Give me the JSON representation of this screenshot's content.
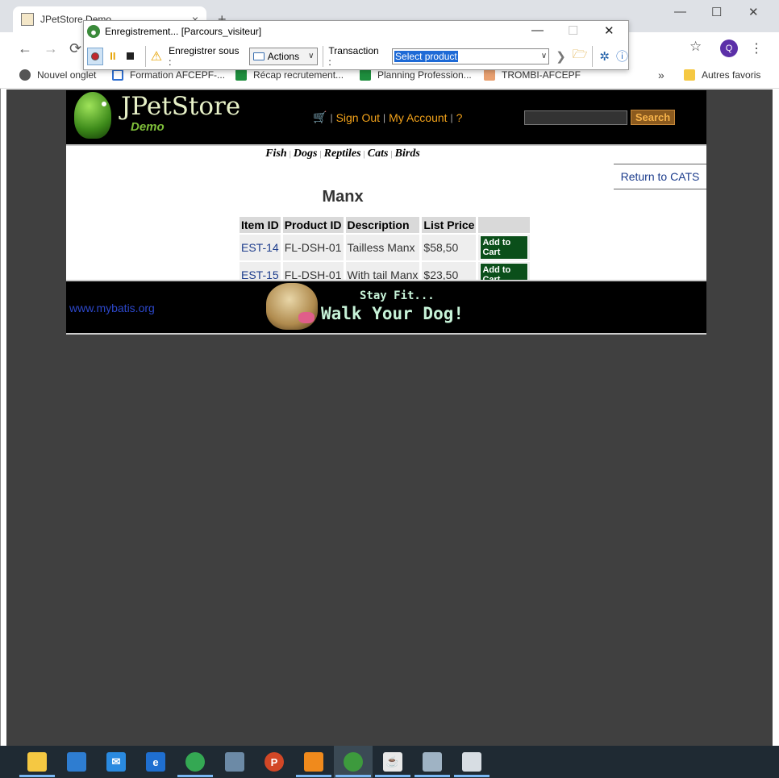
{
  "browser": {
    "tab_title": "JPetStore Demo",
    "tab_close": "×",
    "new_tab": "+",
    "profile_initial": "Q",
    "bookmarks": [
      "Nouvel onglet",
      "Formation AFCEPF-...",
      "Récap recrutement...",
      "Planning Profession...",
      "TROMBI-AFCEPF"
    ],
    "bookmarks_more": "»",
    "other_bookmarks": "Autres favoris"
  },
  "recorder": {
    "title": "Enregistrement... [Parcours_visiteur]",
    "save_as_label": "Enregistrer sous :",
    "actions_label": "Actions",
    "transaction_label": "Transaction :",
    "transaction_value": "Select product"
  },
  "header": {
    "logo_main": "JPetStore",
    "logo_sub": "Demo",
    "sign_out": "Sign Out",
    "my_account": "My Account",
    "help": "?",
    "search_button": "Search"
  },
  "categories": [
    "Fish",
    "Dogs",
    "Reptiles",
    "Cats",
    "Birds"
  ],
  "return_link": "Return to CATS",
  "product": {
    "title": "Manx",
    "columns": [
      "Item ID",
      "Product ID",
      "Description",
      "List Price",
      ""
    ],
    "rows": [
      {
        "item_id": "EST-14",
        "product_id": "FL-DSH-01",
        "description": "Tailless Manx",
        "price": "$58,50",
        "action": "Add to Cart"
      },
      {
        "item_id": "EST-15",
        "product_id": "FL-DSH-01",
        "description": "With tail Manx",
        "price": "$23,50",
        "action": "Add to Cart"
      }
    ]
  },
  "footer": {
    "link": "www.mybatis.org",
    "banner_line1": "Stay Fit...",
    "banner_line2": "Walk Your Dog!"
  },
  "colors": {
    "accent_orange": "#f2a21a",
    "link_blue": "#1c3c8c",
    "cart_green": "#0b4f1a"
  }
}
